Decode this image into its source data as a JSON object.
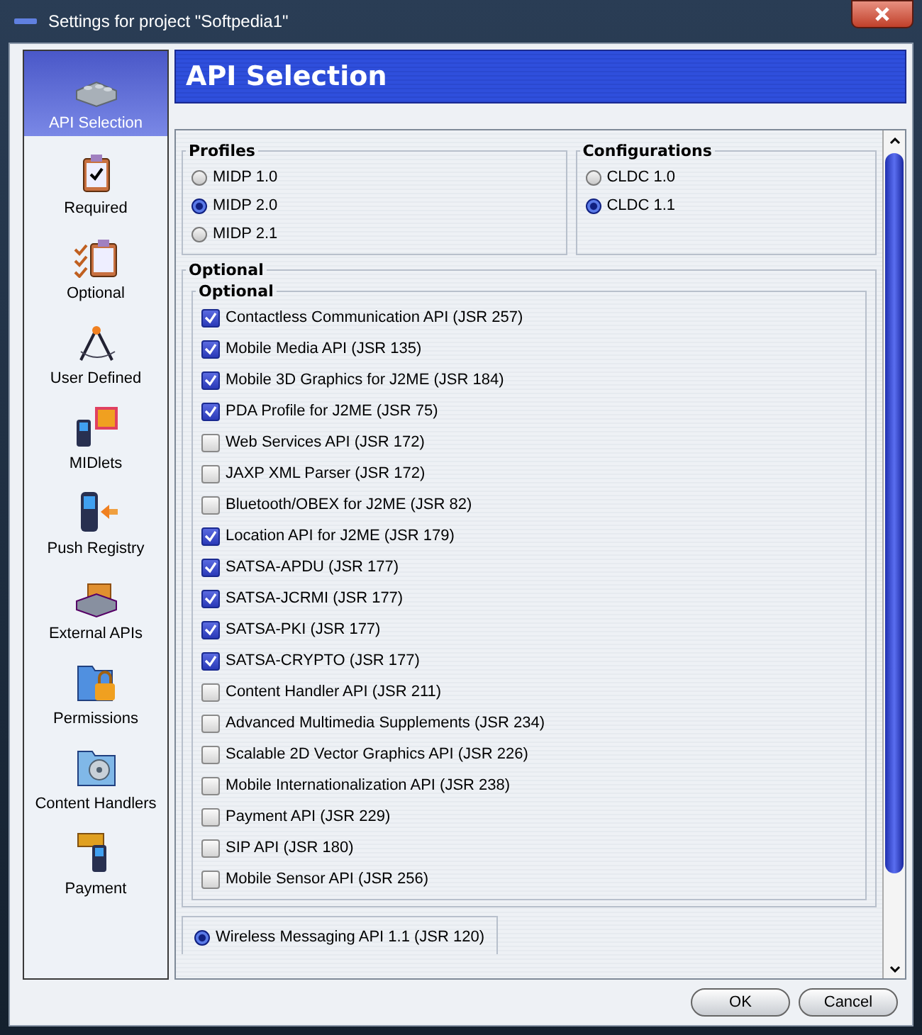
{
  "window": {
    "title": "Settings for project \"Softpedia1\""
  },
  "sidebar": {
    "items": [
      {
        "label": "API Selection",
        "selected": true
      },
      {
        "label": "Required",
        "selected": false
      },
      {
        "label": "Optional",
        "selected": false
      },
      {
        "label": "User Defined",
        "selected": false
      },
      {
        "label": "MIDlets",
        "selected": false
      },
      {
        "label": "Push Registry",
        "selected": false
      },
      {
        "label": "External APIs",
        "selected": false
      },
      {
        "label": "Permissions",
        "selected": false
      },
      {
        "label": "Content Handlers",
        "selected": false
      },
      {
        "label": "Payment",
        "selected": false
      }
    ]
  },
  "header": {
    "title": "API Selection"
  },
  "profiles": {
    "title": "Profiles",
    "options": [
      {
        "label": "MIDP 1.0",
        "selected": false
      },
      {
        "label": "MIDP 2.0",
        "selected": true
      },
      {
        "label": "MIDP 2.1",
        "selected": false
      }
    ]
  },
  "configurations": {
    "title": "Configurations",
    "options": [
      {
        "label": "CLDC 1.0",
        "selected": false
      },
      {
        "label": "CLDC 1.1",
        "selected": true
      }
    ]
  },
  "optional": {
    "title": "Optional",
    "inner_title": "Optional",
    "apis": [
      {
        "label": "Contactless Communication API (JSR 257)",
        "checked": true
      },
      {
        "label": "Mobile Media API (JSR 135)",
        "checked": true
      },
      {
        "label": "Mobile 3D Graphics for J2ME (JSR 184)",
        "checked": true
      },
      {
        "label": "PDA Profile for J2ME (JSR 75)",
        "checked": true
      },
      {
        "label": "Web Services API (JSR 172)",
        "checked": false
      },
      {
        "label": "JAXP XML Parser (JSR 172)",
        "checked": false
      },
      {
        "label": "Bluetooth/OBEX for J2ME (JSR 82)",
        "checked": false
      },
      {
        "label": "Location API for J2ME (JSR 179)",
        "checked": true
      },
      {
        "label": "SATSA-APDU (JSR 177)",
        "checked": true
      },
      {
        "label": "SATSA-JCRMI (JSR 177)",
        "checked": true
      },
      {
        "label": "SATSA-PKI (JSR 177)",
        "checked": true
      },
      {
        "label": "SATSA-CRYPTO (JSR 177)",
        "checked": true
      },
      {
        "label": "Content Handler API (JSR 211)",
        "checked": false
      },
      {
        "label": "Advanced Multimedia Supplements (JSR 234)",
        "checked": false
      },
      {
        "label": "Scalable 2D Vector Graphics API (JSR 226)",
        "checked": false
      },
      {
        "label": "Mobile Internationalization API (JSR 238)",
        "checked": false
      },
      {
        "label": "Payment API (JSR 229)",
        "checked": false
      },
      {
        "label": "SIP API (JSR 180)",
        "checked": false
      },
      {
        "label": "Mobile Sensor API (JSR 256)",
        "checked": false
      }
    ],
    "wireless": {
      "label": "Wireless Messaging API 1.1 (JSR 120)",
      "selected": true
    }
  },
  "buttons": [
    "OK",
    "Cancel"
  ]
}
